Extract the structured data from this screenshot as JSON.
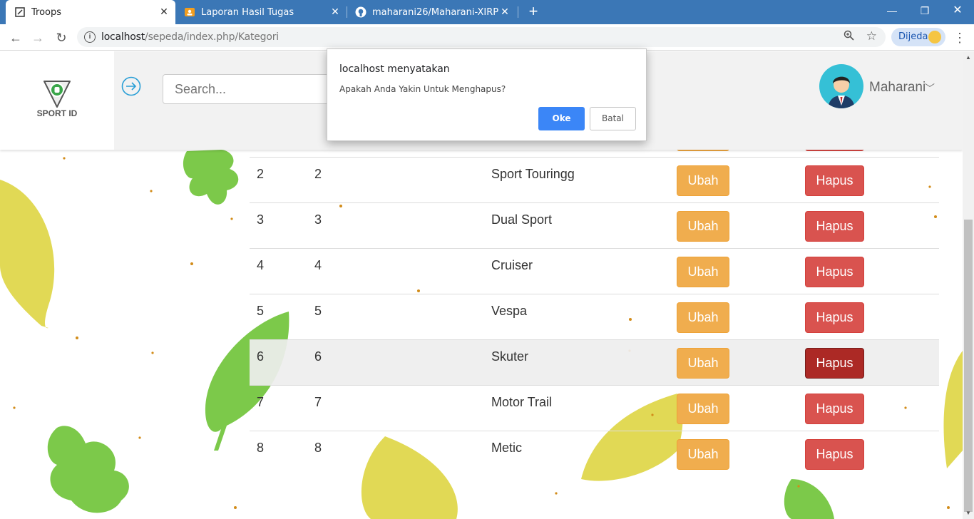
{
  "browser": {
    "tabs": [
      {
        "title": "Troops",
        "active": true
      },
      {
        "title": "Laporan Hasil Tugas",
        "active": false
      },
      {
        "title": "maharani26/Maharani-XIRPL2-2",
        "active": false
      }
    ],
    "url_host": "localhost",
    "url_path": "/sepeda/index.php/Kategori",
    "profile_name": "Dijeda"
  },
  "header": {
    "logo_text": "SPORT ID",
    "search_placeholder": "Search...",
    "username": "Maharani"
  },
  "table": {
    "rows": [
      {
        "no": "2",
        "id": "2",
        "name": "Sport Touringg",
        "edit": "Ubah",
        "delete": "Hapus"
      },
      {
        "no": "3",
        "id": "3",
        "name": "Dual Sport",
        "edit": "Ubah",
        "delete": "Hapus"
      },
      {
        "no": "4",
        "id": "4",
        "name": "Cruiser",
        "edit": "Ubah",
        "delete": "Hapus"
      },
      {
        "no": "5",
        "id": "5",
        "name": "Vespa",
        "edit": "Ubah",
        "delete": "Hapus"
      },
      {
        "no": "6",
        "id": "6",
        "name": "Skuter",
        "edit": "Ubah",
        "delete": "Hapus"
      },
      {
        "no": "7",
        "id": "7",
        "name": "Motor Trail",
        "edit": "Ubah",
        "delete": "Hapus"
      },
      {
        "no": "8",
        "id": "8",
        "name": "Metic",
        "edit": "Ubah",
        "delete": "Hapus"
      }
    ]
  },
  "dialog": {
    "title": "localhost menyatakan",
    "message": "Apakah Anda Yakin Untuk Menghapus?",
    "ok_label": "Oke",
    "cancel_label": "Batal"
  },
  "colors": {
    "tabbar": "#3b77b6",
    "edit_button": "#f0ad4e",
    "delete_button": "#d9534f",
    "delete_button_pressed": "#ac2925",
    "dialog_ok": "#3b86f7"
  }
}
